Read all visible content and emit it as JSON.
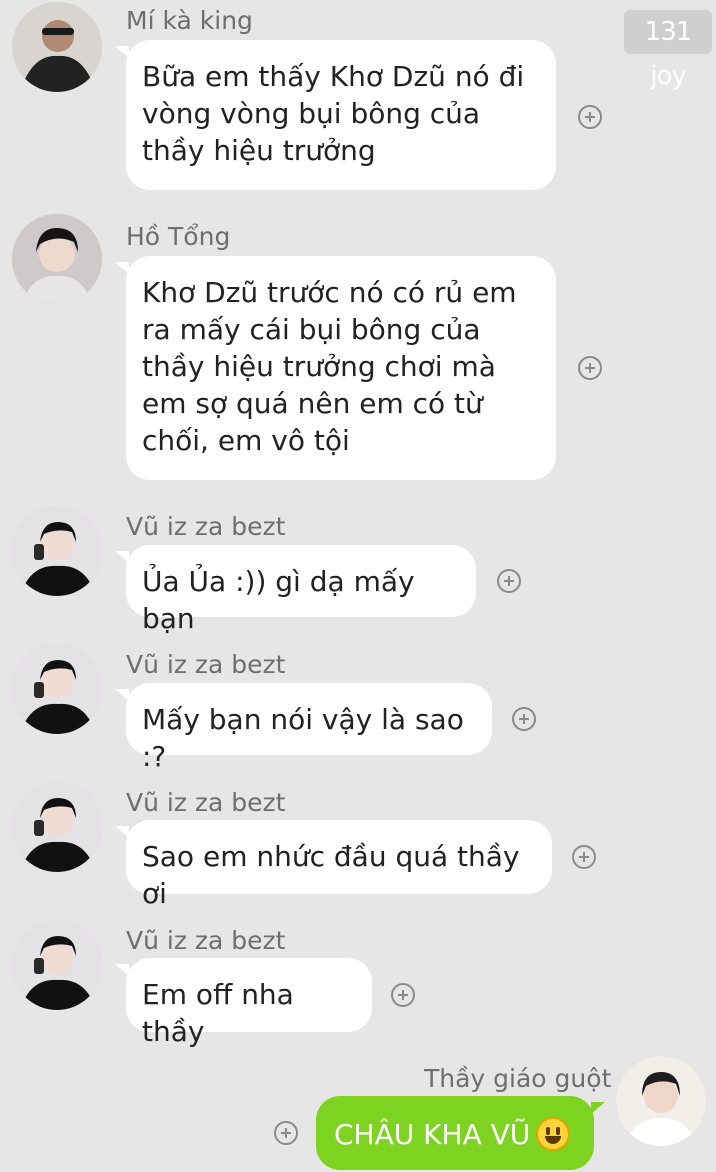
{
  "badge": "131 joy",
  "messages": [
    {
      "sender": "Mí kà king",
      "text": "Bữa em thấy Khơ Dzũ nó đi vòng vòng bụi bông của thầy hiệu trưởng"
    },
    {
      "sender": "Hồ Tổng",
      "text": "Khơ Dzũ trước nó có rủ em ra mấy cái bụi bông của thầy hiệu trưởng chơi mà em sợ quá nên em có từ chối, em vô tội"
    },
    {
      "sender": "Vũ iz za bezt",
      "text": "Ủa Ủa :)) gì dạ mấy bạn"
    },
    {
      "sender": "Vũ iz za bezt",
      "text": "Mấy bạn nói vậy là sao :?"
    },
    {
      "sender": "Vũ iz za bezt",
      "text": "Sao em nhức đầu quá thầy ơi"
    },
    {
      "sender": "Vũ iz za bezt",
      "text": "Em off nha thầy"
    },
    {
      "sender": "Thầy giáo guột",
      "text": "CHÂU KHA VŨ",
      "emoji": "smiley-emoji"
    }
  ]
}
